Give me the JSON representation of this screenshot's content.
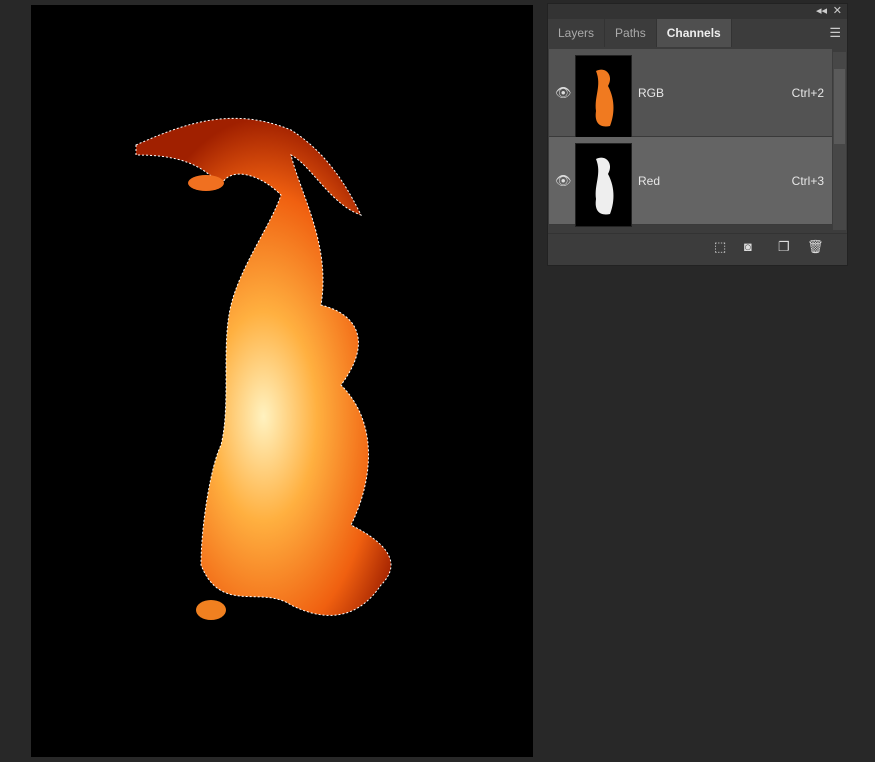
{
  "panel": {
    "tabs": [
      {
        "label": "Layers"
      },
      {
        "label": "Paths"
      },
      {
        "label": "Channels"
      }
    ],
    "active_tab": "Channels",
    "channels": [
      {
        "name": "RGB",
        "shortcut": "Ctrl+2"
      },
      {
        "name": "Red",
        "shortcut": "Ctrl+3"
      }
    ],
    "icons": [
      "collapse-icon",
      "close-icon",
      "menu-icon",
      "eye-icon",
      "load-selection-icon",
      "save-selection-icon",
      "new-channel-icon",
      "delete-icon"
    ]
  }
}
